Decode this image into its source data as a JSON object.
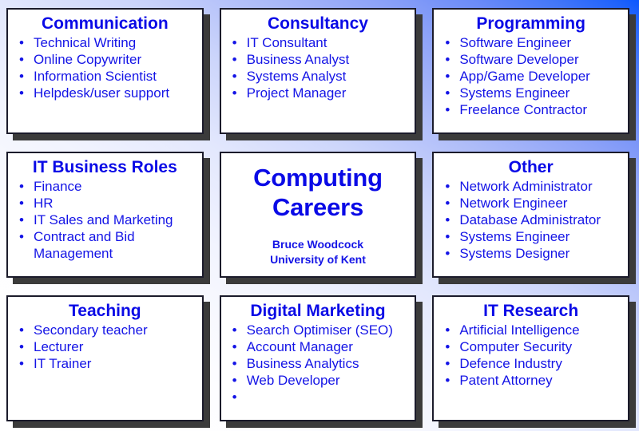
{
  "poster": {
    "title": "Computing Careers",
    "background_start_color": "#ffffff",
    "background_end_color": "#0b57ff",
    "text_color": "#1414e6",
    "card_background": "#ffffff",
    "card_border_color": "#1b1b2b",
    "card_shadow_color": "#3b3b3b"
  },
  "hero": {
    "title_line_1": "Computing",
    "title_line_2": "Careers",
    "author": "Bruce Woodcock",
    "affiliation": "University of Kent"
  },
  "cards": [
    {
      "title": "Communication",
      "items": [
        "Technical Writing",
        "Online Copywriter",
        "Information Scientist",
        "Helpdesk/user support"
      ]
    },
    {
      "title": "Consultancy",
      "items": [
        "IT Consultant",
        "Business Analyst",
        "Systems Analyst",
        "Project Manager"
      ]
    },
    {
      "title": "Programming",
      "items": [
        "Software Engineer",
        "Software Developer",
        "App/Game Developer",
        "Systems Engineer",
        "Freelance Contractor"
      ]
    },
    {
      "title": "IT Business Roles",
      "items": [
        "Finance",
        "HR",
        "IT Sales and Marketing",
        "Contract and Bid Management"
      ]
    },
    {
      "title": "Other",
      "items": [
        "Network Administrator",
        "Network Engineer",
        "Database Administrator",
        "Systems Engineer",
        "Systems Designer"
      ]
    },
    {
      "title": "Teaching",
      "items": [
        "Secondary teacher",
        "Lecturer",
        "IT Trainer"
      ]
    },
    {
      "title": "Digital Marketing",
      "items": [
        "Search Optimiser (SEO)",
        "Account Manager",
        "Business Analytics",
        "Web Developer",
        ""
      ]
    },
    {
      "title": "IT Research",
      "items": [
        "Artificial Intelligence",
        "Computer Security",
        "Defence Industry",
        "Patent Attorney"
      ]
    }
  ],
  "bullet_glyph": "•"
}
